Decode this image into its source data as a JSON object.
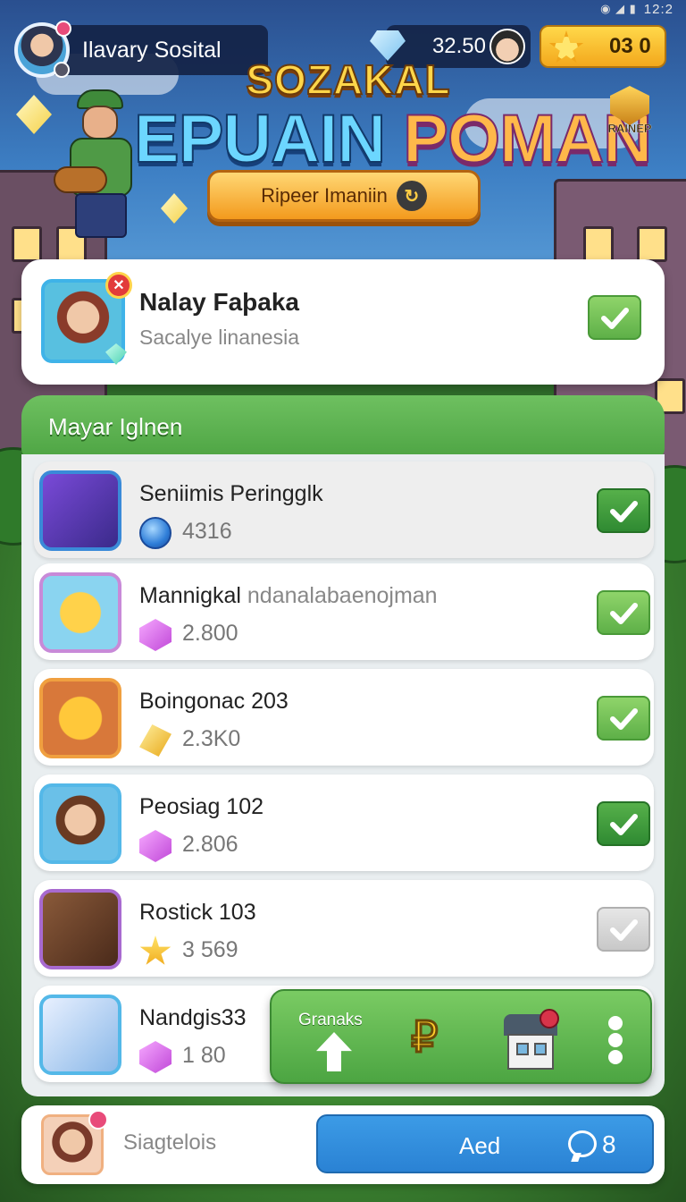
{
  "status_bar": {
    "time": "12:2"
  },
  "header": {
    "profile_name": "Ilavary Sosital",
    "gems": "32.50",
    "coins": "03 0"
  },
  "title": {
    "line1": "SOZAKAL",
    "line2_part1": "EPUAIN",
    "line2_part2": "POMAN",
    "play_button_label": "Ripeer Imaniin",
    "rank_badge_label": "RAINEP"
  },
  "player_card": {
    "name": "Nalay Faþaka",
    "subtitle": "Sacalye linanesia",
    "checked": true
  },
  "section": {
    "title": "Mayar Iglnen"
  },
  "items": [
    {
      "name": "Seniimis Peringglk",
      "extra": "",
      "value": "4316",
      "currency_icon": "orb-icon",
      "check_state": "dark"
    },
    {
      "name": "Mannigkal",
      "extra": "ndanalabaenojman",
      "value": "2.800",
      "currency_icon": "gem-icon",
      "check_state": "on"
    },
    {
      "name": "Boingonac 203",
      "extra": "",
      "value": "2.3K0",
      "currency_icon": "gold-icon",
      "check_state": "on"
    },
    {
      "name": "Peosiag 102",
      "extra": "",
      "value": "2.806",
      "currency_icon": "gem-icon",
      "check_state": "dark"
    },
    {
      "name": "Rostick 103",
      "extra": "",
      "value": "3 569",
      "currency_icon": "star-icon",
      "check_state": "off"
    },
    {
      "name": "Nandgis33",
      "extra": "",
      "value": "1 80",
      "currency_icon": "gem-icon",
      "check_state": "none"
    }
  ],
  "action_bar": {
    "label": "Granaks",
    "icons": [
      "up-arrow-icon",
      "coin-symbol-icon",
      "house-icon",
      "more-vertical-icon"
    ]
  },
  "bottom_bar": {
    "label": "Siagtelois",
    "button_label": "Aed",
    "message_count": "8"
  },
  "colors": {
    "accent_green": "#4ea544",
    "button_blue": "#2a82d4",
    "gold": "#f3a81c"
  }
}
